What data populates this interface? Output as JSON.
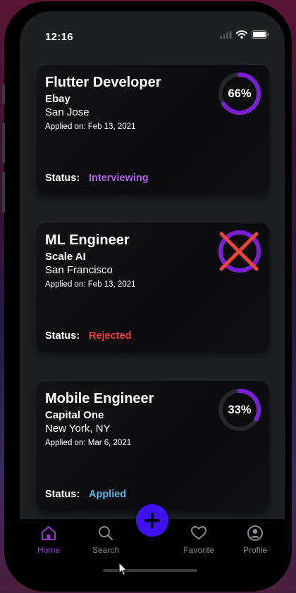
{
  "status_bar": {
    "time": "12:16"
  },
  "cards": [
    {
      "title": "Flutter Developer",
      "company": "Ebay",
      "location": "San Jose",
      "applied": "Applied on: Feb 13, 2021",
      "status_label": "Status:",
      "status": "Interviewing",
      "status_color": "#b35ee6",
      "progress_text": "66%",
      "progress": 0.66
    },
    {
      "title": "ML Engineer",
      "company": "Scale AI",
      "location": "San Francisco",
      "applied": "Applied on: Feb 13, 2021",
      "status_label": "Status:",
      "status": "Rejected",
      "status_color": "#f03a3a",
      "progress": 1.0,
      "rejected_mark": "x-mark-icon"
    },
    {
      "title": "Mobile Engineer",
      "company": "Capital One",
      "location": "New York, NY",
      "applied": "Applied on: Mar 6, 2021",
      "status_label": "Status:",
      "status": "Applied",
      "status_color": "#52b8ee",
      "progress_text": "33%",
      "progress": 0.33
    }
  ],
  "tabs": [
    {
      "label": "Home",
      "icon": "home-icon",
      "active": true
    },
    {
      "label": "Search",
      "icon": "search-icon",
      "active": false
    },
    {
      "label": "Favorite",
      "icon": "heart-icon",
      "active": false
    },
    {
      "label": "Profile",
      "icon": "profile-icon",
      "active": false
    }
  ],
  "fab": {
    "icon": "plus-icon",
    "color": "#3f12f2"
  },
  "colors": {
    "accent": "#7a1fd6",
    "ring_track": "#26272b",
    "tab_active": "#9a35d6",
    "tab_inactive": "#8a8a8e"
  }
}
